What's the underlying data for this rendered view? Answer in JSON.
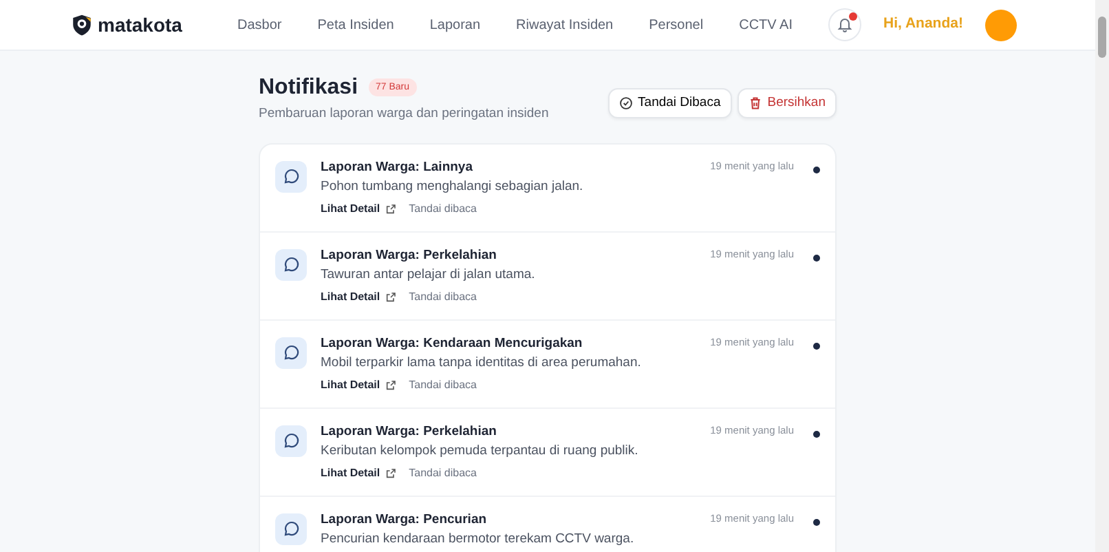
{
  "brand": "matakota",
  "nav": [
    {
      "label": "Dasbor"
    },
    {
      "label": "Peta Insiden"
    },
    {
      "label": "Laporan"
    },
    {
      "label": "Riwayat Insiden"
    },
    {
      "label": "Personel"
    },
    {
      "label": "CCTV AI"
    }
  ],
  "header": {
    "bell_alert": true,
    "greeting": "Hi, Ananda!"
  },
  "page": {
    "title": "Notifikasi",
    "badge": "77 Baru",
    "subtitle": "Pembaruan laporan warga dan peringatan insiden",
    "buttons": [
      {
        "kind": "mark-read",
        "label": "Tandai Dibaca"
      },
      {
        "kind": "clear",
        "label": "Bersihkan"
      }
    ]
  },
  "notifications": [
    {
      "title": "Laporan Warga: Lainnya",
      "message": "Pohon tumbang menghalangi sebagian jalan.",
      "time": "19 menit yang lalu",
      "unread": true,
      "actions": [
        "Lihat Detail",
        "Tandai dibaca"
      ]
    },
    {
      "title": "Laporan Warga: Perkelahian",
      "message": "Tawuran antar pelajar di jalan utama.",
      "time": "19 menit yang lalu",
      "unread": true,
      "actions": [
        "Lihat Detail",
        "Tandai dibaca"
      ]
    },
    {
      "title": "Laporan Warga: Kendaraan Mencurigakan",
      "message": "Mobil terparkir lama tanpa identitas di area perumahan.",
      "time": "19 menit yang lalu",
      "unread": true,
      "actions": [
        "Lihat Detail",
        "Tandai dibaca"
      ]
    },
    {
      "title": "Laporan Warga: Perkelahian",
      "message": "Keributan kelompok pemuda terpantau di ruang publik.",
      "time": "19 menit yang lalu",
      "unread": true,
      "actions": [
        "Lihat Detail",
        "Tandai dibaca"
      ]
    },
    {
      "title": "Laporan Warga: Pencurian",
      "message": "Pencurian kendaraan bermotor terekam CCTV warga.",
      "time": "19 menit yang lalu",
      "unread": true
    }
  ]
}
